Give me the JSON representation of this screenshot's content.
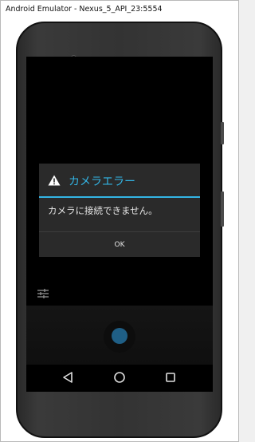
{
  "window": {
    "title": "Android Emulator - Nexus_5_API_23:5554"
  },
  "dialog": {
    "title": "カメラエラー",
    "message": "カメラに接続できません。",
    "ok_label": "OK",
    "icon": "warning-icon"
  },
  "colors": {
    "accent": "#33b5e5",
    "dialog_bg": "#2a2a2a",
    "shutter": "#1f5f86"
  },
  "icons": {
    "settings": "settings-sliders-icon",
    "shutter": "shutter-button",
    "nav_back": "back-triangle-icon",
    "nav_home": "home-circle-icon",
    "nav_recent": "recent-square-icon"
  }
}
